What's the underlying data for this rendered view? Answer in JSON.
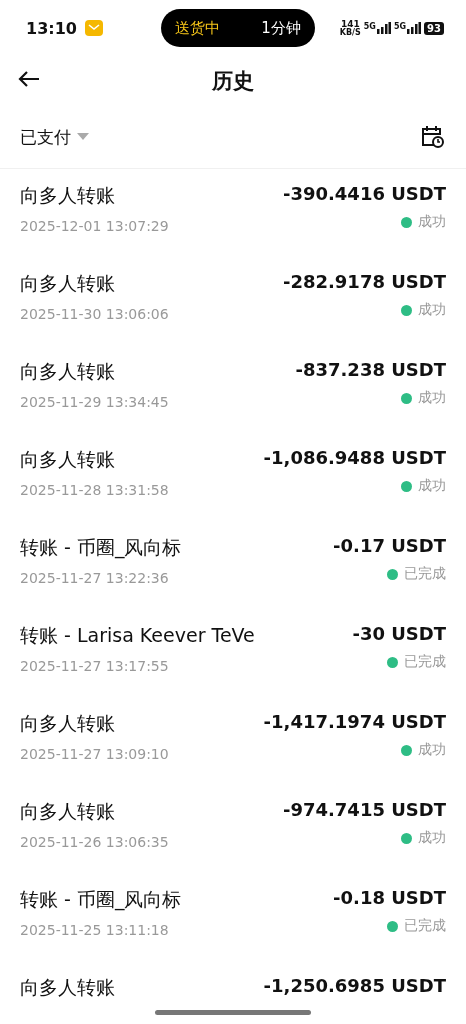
{
  "status_bar": {
    "time": "13:10",
    "activity": {
      "label": "送货中",
      "duration": "1分钟"
    },
    "net_speed": "141",
    "net_unit": "KB/S",
    "signals": [
      "5G",
      "5G"
    ],
    "battery": "93"
  },
  "header": {
    "title": "历史"
  },
  "filter": {
    "label": "已支付"
  },
  "transactions": [
    {
      "title": "向多人转账",
      "time": "2025-12-01 13:07:29",
      "amount": "-390.4416 USDT",
      "status": "成功",
      "color": "#2ebd85"
    },
    {
      "title": "向多人转账",
      "time": "2025-11-30 13:06:06",
      "amount": "-282.9178 USDT",
      "status": "成功",
      "color": "#2ebd85"
    },
    {
      "title": "向多人转账",
      "time": "2025-11-29 13:34:45",
      "amount": "-837.238 USDT",
      "status": "成功",
      "color": "#2ebd85"
    },
    {
      "title": "向多人转账",
      "time": "2025-11-28 13:31:58",
      "amount": "-1,086.9488 USDT",
      "status": "成功",
      "color": "#2ebd85"
    },
    {
      "title": "转账 - 币圈_风向标",
      "time": "2025-11-27 13:22:36",
      "amount": "-0.17 USDT",
      "status": "已完成",
      "color": "#2ebd85"
    },
    {
      "title": "转账 - Larisa Keever TeVe",
      "time": "2025-11-27 13:17:55",
      "amount": "-30 USDT",
      "status": "已完成",
      "color": "#2ebd85"
    },
    {
      "title": "向多人转账",
      "time": "2025-11-27 13:09:10",
      "amount": "-1,417.1974 USDT",
      "status": "成功",
      "color": "#2ebd85"
    },
    {
      "title": "向多人转账",
      "time": "2025-11-26 13:06:35",
      "amount": "-974.7415 USDT",
      "status": "成功",
      "color": "#2ebd85"
    },
    {
      "title": "转账 - 币圈_风向标",
      "time": "2025-11-25 13:11:18",
      "amount": "-0.18 USDT",
      "status": "已完成",
      "color": "#2ebd85"
    },
    {
      "title": "向多人转账",
      "amount": "-1,250.6985 USDT"
    }
  ]
}
